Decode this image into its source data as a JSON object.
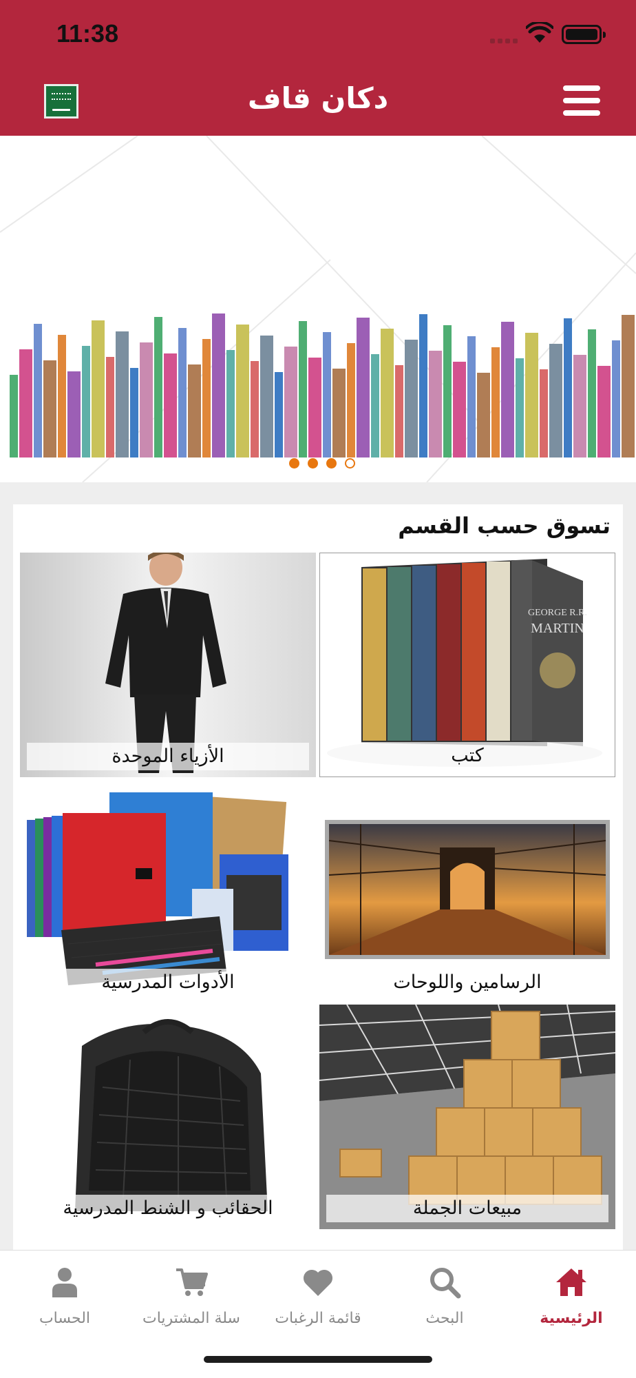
{
  "status_bar": {
    "time": "11:38"
  },
  "header": {
    "title": "دكان قاف",
    "flag_icon": "saudi-flag-icon",
    "menu_icon": "hamburger-menu-icon",
    "color": "#b3263d"
  },
  "banner": {
    "slide_count": 4,
    "active_slide": 4,
    "dot_color": "#e8770f"
  },
  "categories": {
    "title": "تسوق حسب القسم",
    "items": [
      {
        "label": "كتب",
        "image": "books-box-set-image"
      },
      {
        "label": "الأزياء الموحدة",
        "image": "man-in-suit-image"
      },
      {
        "label": "الرسامين واللوحات",
        "image": "bridge-painting-image"
      },
      {
        "label": "الأدوات المدرسية",
        "image": "school-supplies-image"
      },
      {
        "label": "مبيعات الجملة",
        "image": "warehouse-boxes-image"
      },
      {
        "label": "الحقائب و الشنط المدرسية",
        "image": "backpack-image"
      }
    ]
  },
  "tabbar": {
    "active_color": "#b3263d",
    "items": [
      {
        "label": "الرئيسية",
        "icon": "home-icon",
        "active": true
      },
      {
        "label": "البحث",
        "icon": "search-icon",
        "active": false
      },
      {
        "label": "قائمة الرغبات",
        "icon": "heart-icon",
        "active": false
      },
      {
        "label": "سلة المشتريات",
        "icon": "cart-icon",
        "active": false
      },
      {
        "label": "الحساب",
        "icon": "user-icon",
        "active": false
      }
    ]
  }
}
